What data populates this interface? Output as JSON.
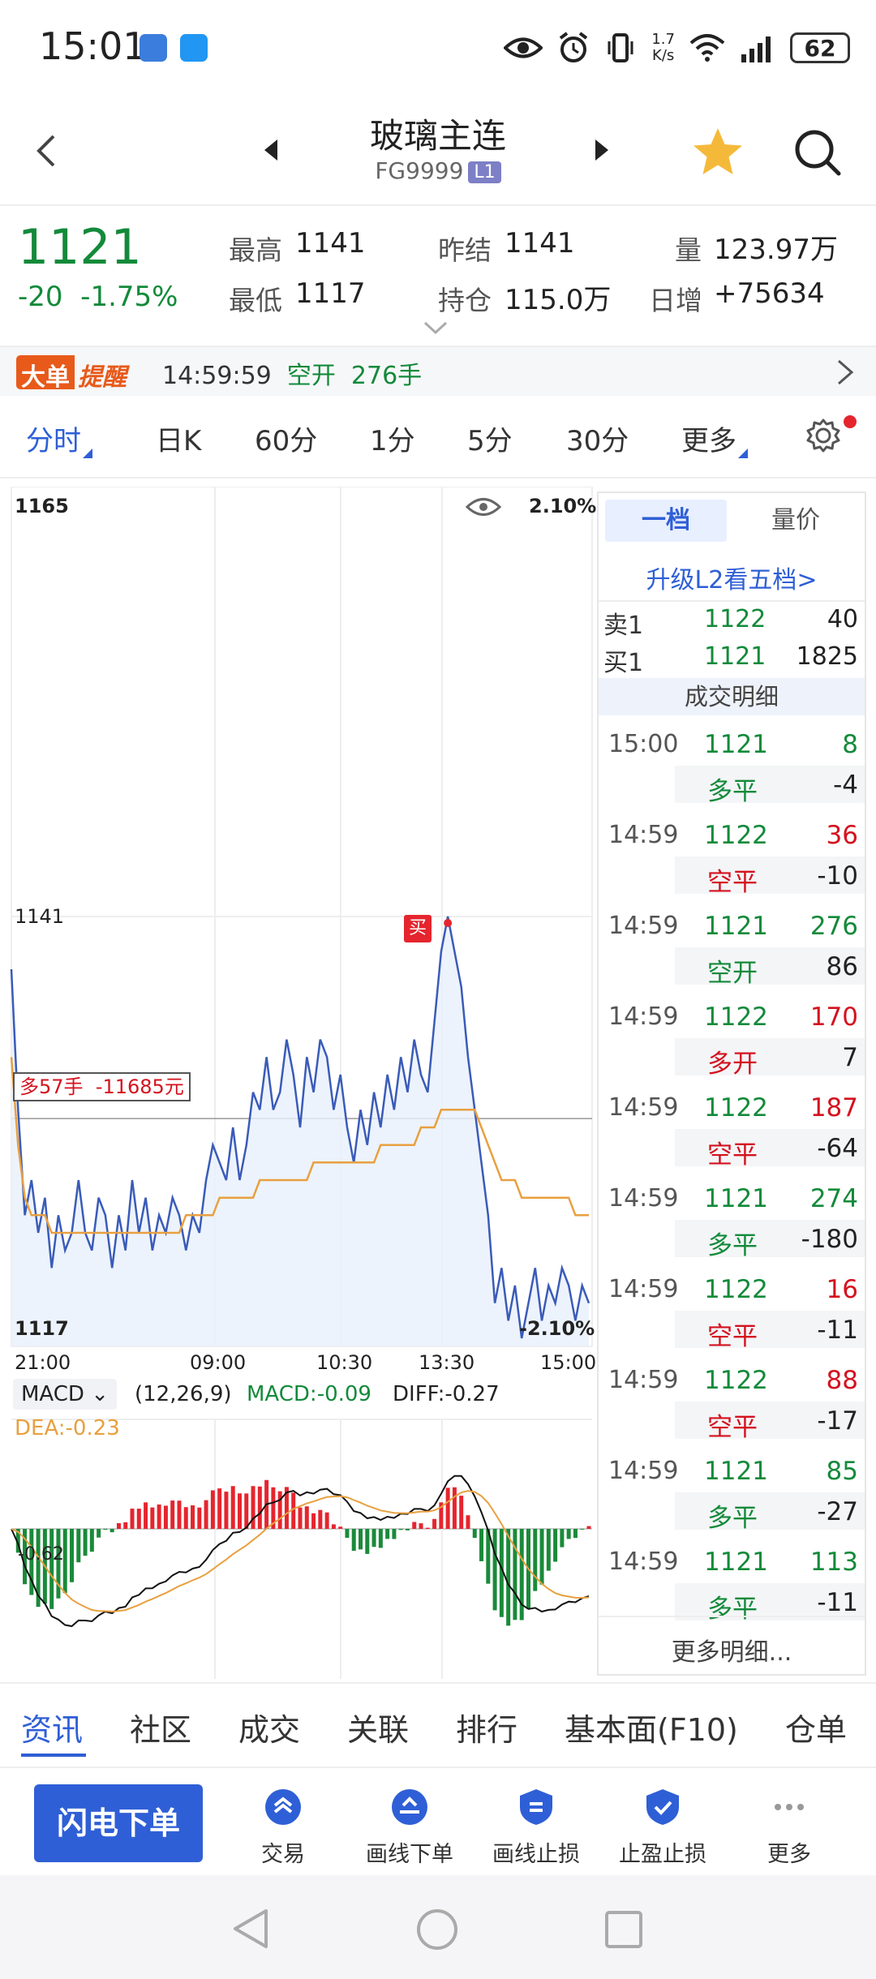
{
  "status_bar": {
    "time": "15:01",
    "net_speed_top": "1.7",
    "net_speed_bottom": "K/s",
    "wifi_label": "6",
    "battery": "62"
  },
  "header": {
    "title": "玻璃主连",
    "code": "FG9999",
    "level": "L1"
  },
  "quote": {
    "last_price": "1121",
    "change": "-20",
    "change_pct": "-1.75%",
    "high_label": "最高",
    "high": "1141",
    "low_label": "最低",
    "low": "1117",
    "prev_settle_label": "昨结",
    "prev_settle": "1141",
    "open_interest_label": "持仓",
    "open_interest": "115.0万",
    "volume_label": "量",
    "volume": "123.97万",
    "daily_change_label": "日增",
    "daily_change": "+75634"
  },
  "alert": {
    "tag1": "大单",
    "tag2": "提醒",
    "time": "14:59:59",
    "action": "空开",
    "lots": "276手"
  },
  "period_tabs": [
    {
      "label": "分时",
      "active": true
    },
    {
      "label": "日K"
    },
    {
      "label": "60分"
    },
    {
      "label": "1分"
    },
    {
      "label": "5分"
    },
    {
      "label": "30分"
    },
    {
      "label": "更多"
    }
  ],
  "chart_data": {
    "type": "line",
    "title": "",
    "y_top_label": "1165",
    "y_mid_label": "1141",
    "y_bottom_label": "1117",
    "pct_top": "2.10%",
    "pct_bottom": "-2.10%",
    "ylim": [
      1117,
      1165
    ],
    "x_ticks": [
      "21:00",
      "09:00",
      "10:30",
      "13:30",
      "15:00"
    ],
    "buy_marker": "买",
    "position_label": "多57手",
    "position_pnl": "-11685元",
    "series": [
      {
        "values": [
          1138,
          1130,
          1124,
          1126,
          1123,
          1125,
          1121,
          1124,
          1122,
          1123,
          1126,
          1123,
          1122,
          1125,
          1124,
          1121,
          1124,
          1122,
          1126,
          1123,
          1125,
          1122,
          1124,
          1123,
          1125,
          1124,
          1122,
          1124,
          1123,
          1126,
          1128,
          1127,
          1126,
          1129,
          1126,
          1128,
          1131,
          1130,
          1133,
          1130,
          1131,
          1134,
          1132,
          1129,
          1133,
          1131,
          1134,
          1133,
          1130,
          1132,
          1129,
          1127,
          1130,
          1128,
          1131,
          1129,
          1132,
          1130,
          1133,
          1131,
          1134,
          1132,
          1131,
          1135,
          1139,
          1141,
          1139,
          1137,
          1133,
          1130,
          1127,
          1124,
          1119,
          1121,
          1118,
          1120,
          1117,
          1119,
          1121,
          1118,
          1120,
          1119,
          1121,
          1120,
          1118,
          1120,
          1119
        ]
      },
      {
        "values": [
          1133,
          1128,
          1125,
          1124,
          1124,
          1124,
          1123,
          1123,
          1123,
          1123,
          1123,
          1123,
          1123,
          1123,
          1123,
          1123,
          1123,
          1123,
          1123,
          1123,
          1123,
          1123,
          1123,
          1123,
          1123,
          1123,
          1124,
          1124,
          1124,
          1124,
          1124,
          1125,
          1125,
          1125,
          1125,
          1125,
          1125,
          1126,
          1126,
          1126,
          1126,
          1126,
          1126,
          1126,
          1126,
          1127,
          1127,
          1127,
          1127,
          1127,
          1127,
          1127,
          1127,
          1127,
          1127,
          1128,
          1128,
          1128,
          1128,
          1128,
          1128,
          1129,
          1129,
          1129,
          1130,
          1130,
          1130,
          1130,
          1130,
          1130,
          1129,
          1128,
          1127,
          1126,
          1126,
          1126,
          1125,
          1125,
          1125,
          1125,
          1125,
          1125,
          1125,
          1125,
          1124,
          1124,
          1124
        ]
      }
    ],
    "macd": {
      "indicator": "MACD",
      "params": "(12,26,9)",
      "macd_text": "MACD:-0.09",
      "diff_text": "DIFF:-0.27",
      "dea_text": "DEA:-0.23",
      "axis_label": "-0.62"
    }
  },
  "order_book": {
    "tab1": "一档",
    "tab2": "量价",
    "upgrade": "升级L2看五档>",
    "ask_label": "卖1",
    "ask_price": "1122",
    "ask_vol": "40",
    "bid_label": "买1",
    "bid_price": "1121",
    "bid_vol": "1825",
    "detail_title": "成交明细",
    "trades": [
      {
        "time": "15:00",
        "price": "1121",
        "vol": "8",
        "type": "多平",
        "oi": "-4",
        "price_color": "#138a3a",
        "vol_color": "#138a3a",
        "type_color": "#138a3a"
      },
      {
        "time": "14:59",
        "price": "1122",
        "vol": "36",
        "type": "空平",
        "oi": "-10",
        "price_color": "#138a3a",
        "vol_color": "#d4121f",
        "type_color": "#d4121f"
      },
      {
        "time": "14:59",
        "price": "1121",
        "vol": "276",
        "type": "空开",
        "oi": "86",
        "price_color": "#138a3a",
        "vol_color": "#138a3a",
        "type_color": "#138a3a"
      },
      {
        "time": "14:59",
        "price": "1122",
        "vol": "170",
        "type": "多开",
        "oi": "7",
        "price_color": "#138a3a",
        "vol_color": "#d4121f",
        "type_color": "#d4121f"
      },
      {
        "time": "14:59",
        "price": "1122",
        "vol": "187",
        "type": "空平",
        "oi": "-64",
        "price_color": "#138a3a",
        "vol_color": "#d4121f",
        "type_color": "#d4121f"
      },
      {
        "time": "14:59",
        "price": "1121",
        "vol": "274",
        "type": "多平",
        "oi": "-180",
        "price_color": "#138a3a",
        "vol_color": "#138a3a",
        "type_color": "#138a3a"
      },
      {
        "time": "14:59",
        "price": "1122",
        "vol": "16",
        "type": "空平",
        "oi": "-11",
        "price_color": "#138a3a",
        "vol_color": "#d4121f",
        "type_color": "#d4121f"
      },
      {
        "time": "14:59",
        "price": "1122",
        "vol": "88",
        "type": "空平",
        "oi": "-17",
        "price_color": "#138a3a",
        "vol_color": "#d4121f",
        "type_color": "#d4121f"
      },
      {
        "time": "14:59",
        "price": "1121",
        "vol": "85",
        "type": "多平",
        "oi": "-27",
        "price_color": "#138a3a",
        "vol_color": "#138a3a",
        "type_color": "#138a3a"
      },
      {
        "time": "14:59",
        "price": "1121",
        "vol": "113",
        "type": "多平",
        "oi": "-11",
        "price_color": "#138a3a",
        "vol_color": "#138a3a",
        "type_color": "#138a3a"
      }
    ],
    "more": "更多明细..."
  },
  "bottom_tabs": [
    "资讯",
    "社区",
    "成交",
    "关联",
    "排行",
    "基本面(F10)",
    "仓单"
  ],
  "actions": {
    "flash_order": "闪电下单",
    "items": [
      {
        "label": "交易",
        "icon": "trade-icon"
      },
      {
        "label": "画线下单",
        "icon": "draw-order-icon"
      },
      {
        "label": "画线止损",
        "icon": "draw-stoploss-icon"
      },
      {
        "label": "止盈止损",
        "icon": "take-profit-icon"
      },
      {
        "label": "更多",
        "icon": "more-dots-icon"
      }
    ]
  },
  "colors": {
    "accent": "#2f5fd6",
    "up": "#d4121f",
    "down": "#138a3a",
    "price_line": "#3a5bb8",
    "avg_line": "#e8a040"
  }
}
